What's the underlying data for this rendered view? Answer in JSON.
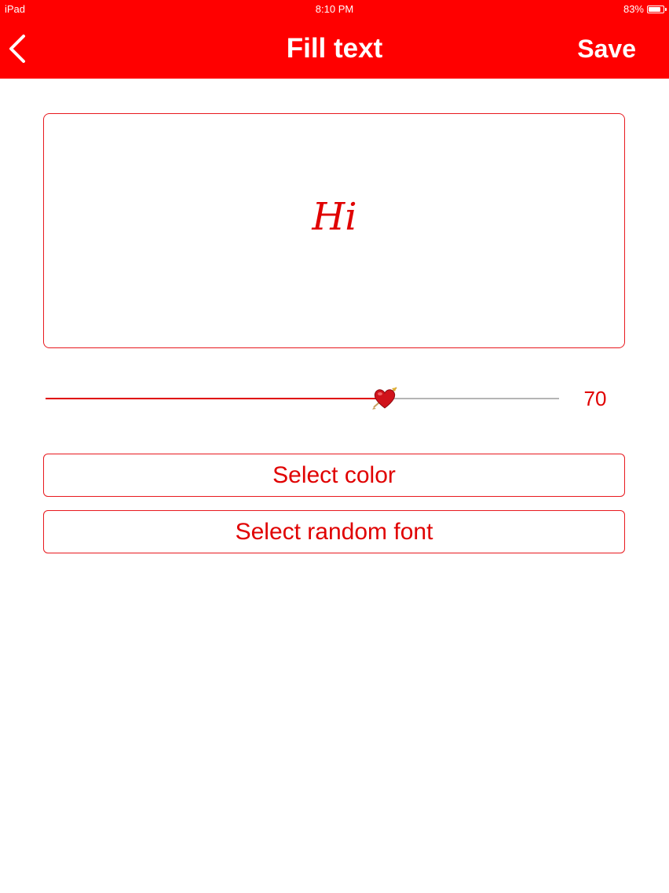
{
  "status_bar": {
    "device": "iPad",
    "time": "8:10 PM",
    "battery": "83%",
    "battery_level": 0.83
  },
  "nav": {
    "back_icon": "chevron-left-icon",
    "title": "Fill text",
    "save_label": "Save"
  },
  "preview": {
    "text": "Hi"
  },
  "slider": {
    "value": 70,
    "fraction": 0.66,
    "value_label": "70",
    "thumb_icon": "heart-arrow-icon"
  },
  "buttons": {
    "select_color": "Select color",
    "select_random_font": "Select random font"
  },
  "colors": {
    "accent": "#ff0000",
    "text_red": "#e00000",
    "track": "#b5b5b5"
  }
}
